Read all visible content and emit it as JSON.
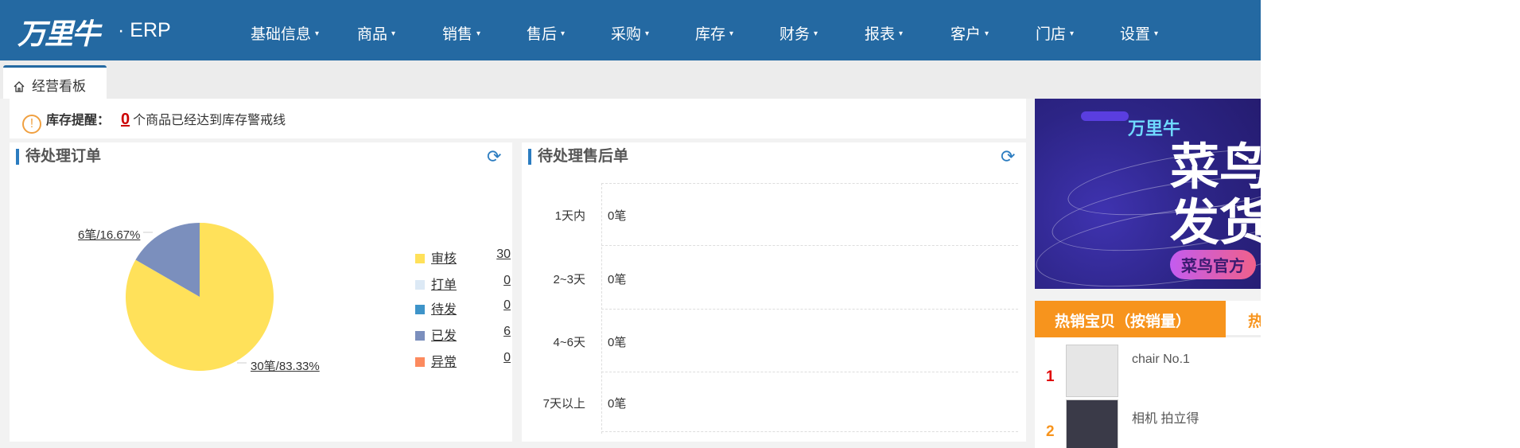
{
  "header": {
    "logo": "万里牛",
    "product": "· ERP",
    "nav": [
      "基础信息",
      "商品",
      "销售",
      "售后",
      "采购",
      "库存",
      "财务",
      "报表",
      "客户",
      "门店",
      "设置"
    ]
  },
  "tabs": [
    {
      "label": "经营看板"
    }
  ],
  "alert": {
    "label": "库存提醒：",
    "count": "0",
    "message": "个商品已经达到库存警戒线"
  },
  "orders_panel": {
    "title": "待处理订单",
    "chart_data": {
      "type": "pie",
      "title": "待处理订单",
      "slices": [
        {
          "name": "审核",
          "value": 30,
          "color": "#ffe15a"
        },
        {
          "name": "打单",
          "value": 0,
          "color": "#dce9f5"
        },
        {
          "name": "待发",
          "value": 0,
          "color": "#3e94c9"
        },
        {
          "name": "已发",
          "value": 6,
          "color": "#7b8fbd"
        },
        {
          "name": "异常",
          "value": 0,
          "color": "#fc8a5e"
        }
      ],
      "labels": [
        "30笔/83.33%",
        "6笔/16.67%"
      ],
      "legend": "right"
    }
  },
  "aftersale_panel": {
    "title": "待处理售后单",
    "rows": [
      {
        "label": "1天内",
        "value": "0笔"
      },
      {
        "label": "2~3天",
        "value": "0笔"
      },
      {
        "label": "4~6天",
        "value": "0笔"
      },
      {
        "label": "7天以上",
        "value": "0笔"
      }
    ]
  },
  "banner": {
    "line1": "万里牛",
    "line2": "菜鸟",
    "line3": "发货",
    "pill": "菜鸟官方"
  },
  "hot": {
    "tab_active": "热销宝贝（按销量）",
    "tab_other": "热",
    "items": [
      {
        "rank": "1",
        "name": "chair No.1",
        "rank_color": "#e00000"
      },
      {
        "rank": "2",
        "name": "相机 拍立得",
        "rank_color": "#f7941d"
      }
    ]
  }
}
